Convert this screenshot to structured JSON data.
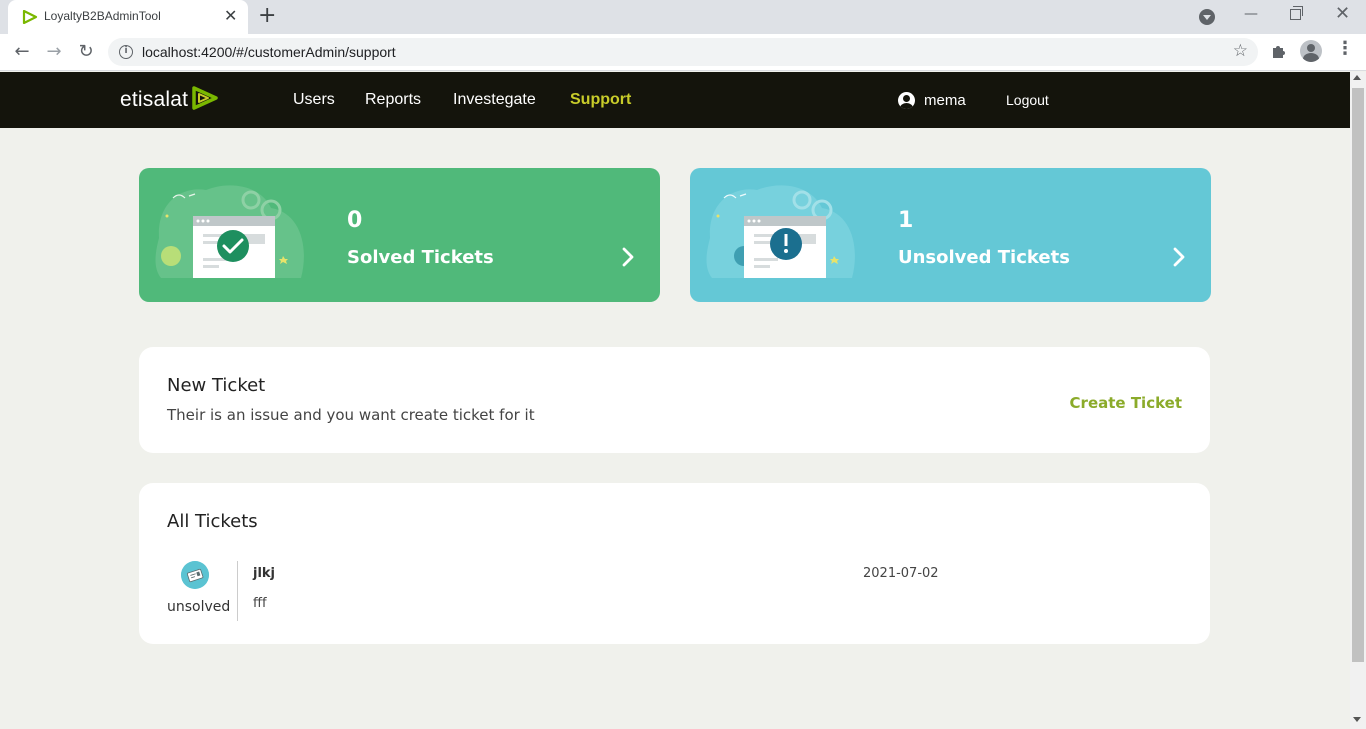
{
  "browser": {
    "tab_title": "LoyaltyB2BAdminTool",
    "tab_close": "✕",
    "new_tab": "+",
    "url": "localhost:4200/#/customerAdmin/support",
    "back": "←",
    "forward": "→",
    "reload": "↻",
    "bookmark": "☆",
    "window_min": "—",
    "window_close": "✕",
    "menu": "⋮",
    "info": "i"
  },
  "header": {
    "brand": "etisalat",
    "nav": [
      "Users",
      "Reports",
      "Investegate",
      "Support"
    ],
    "active_nav": "Support",
    "active_color": "#c8cc2a",
    "username": "mema",
    "logout": "Logout"
  },
  "stats": {
    "solved": {
      "count": "0",
      "label": "Solved Tickets",
      "color": "#50b97a"
    },
    "unsolved": {
      "count": "1",
      "label": "Unsolved Tickets",
      "color": "#64c8d6"
    }
  },
  "new_ticket": {
    "title": "New Ticket",
    "description": "Their is an issue and you want create ticket for it",
    "action": "Create Ticket",
    "action_color": "#8bab2a"
  },
  "all_tickets": {
    "title": "All Tickets",
    "items": [
      {
        "status": "unsolved",
        "title": "jlkj",
        "body": "fff",
        "date": "2021-07-02"
      }
    ]
  }
}
